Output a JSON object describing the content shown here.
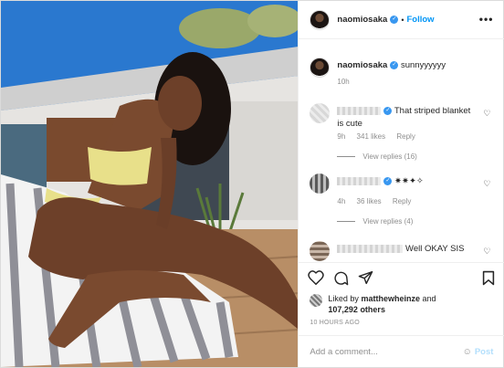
{
  "post": {
    "username": "naomiosaka",
    "follow_label": "Follow",
    "more_icon": "•••",
    "caption_text": "sunnyyyyyy",
    "caption_time": "10h"
  },
  "comments": [
    {
      "text": "That striped blanket is cute",
      "time": "9h",
      "likes": "341 likes",
      "reply": "Reply",
      "view_replies": "View replies (16)"
    },
    {
      "text": "✷✷✦✧",
      "time": "4h",
      "likes": "36 likes",
      "reply": "Reply",
      "view_replies": "View replies (4)"
    },
    {
      "text": "Well OKAY SIS"
    }
  ],
  "footer": {
    "liked_prefix": "Liked by",
    "liked_user": "matthewheinze",
    "liked_and": "and",
    "liked_others": "107,292 others",
    "time_ago": "10 HOURS AGO",
    "add_comment_placeholder": "Add a comment...",
    "emoji_glyph": "☺",
    "post_label": "Post"
  },
  "colors": {
    "link_blue": "#0095f6",
    "muted": "#8e8e8e",
    "post_disabled": "#b2dffc",
    "verified": "#3897f0"
  }
}
